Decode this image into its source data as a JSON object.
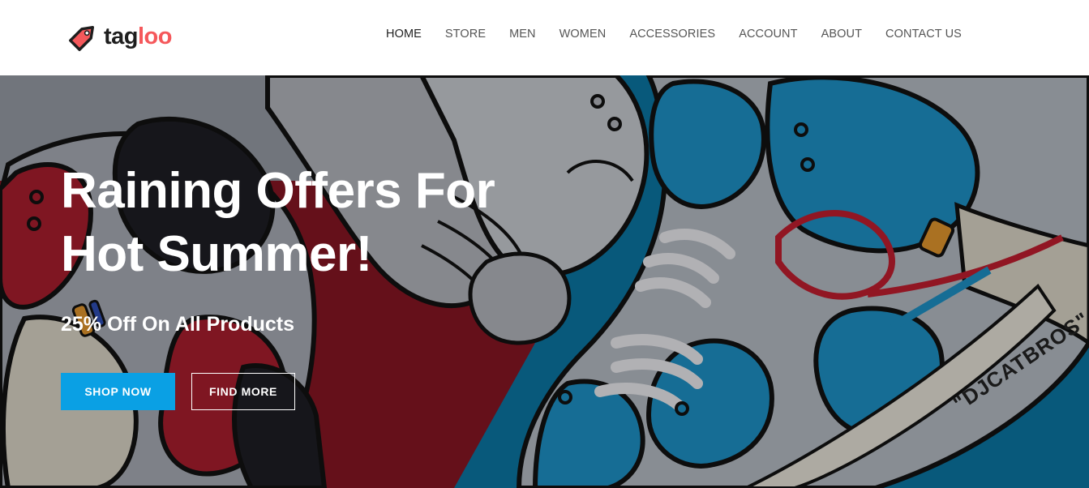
{
  "brand": {
    "name_part1": "tag",
    "name_part2": "loo",
    "icon": "price-tag-icon",
    "accent_color": "#f5585b"
  },
  "nav": {
    "items": [
      {
        "label": "HOME",
        "active": true
      },
      {
        "label": "STORE",
        "active": false
      },
      {
        "label": "MEN",
        "active": false
      },
      {
        "label": "WOMEN",
        "active": false
      },
      {
        "label": "ACCESSORIES",
        "active": false
      },
      {
        "label": "ACCOUNT",
        "active": false
      },
      {
        "label": "ABOUT",
        "active": false
      },
      {
        "label": "CONTACT US",
        "active": false
      }
    ]
  },
  "hero": {
    "title_line1": "Raining Offers For",
    "title_line2": "Hot Summer!",
    "subtitle": "25% Off On All Products",
    "primary_button": "SHOP NOW",
    "secondary_button": "FIND MORE",
    "artwork_text": "\"DJCATBROS\"",
    "colors": {
      "red_panel": "#7c1420",
      "blue_panel": "#0a6d96",
      "button_blue": "#0aa0e4"
    }
  }
}
